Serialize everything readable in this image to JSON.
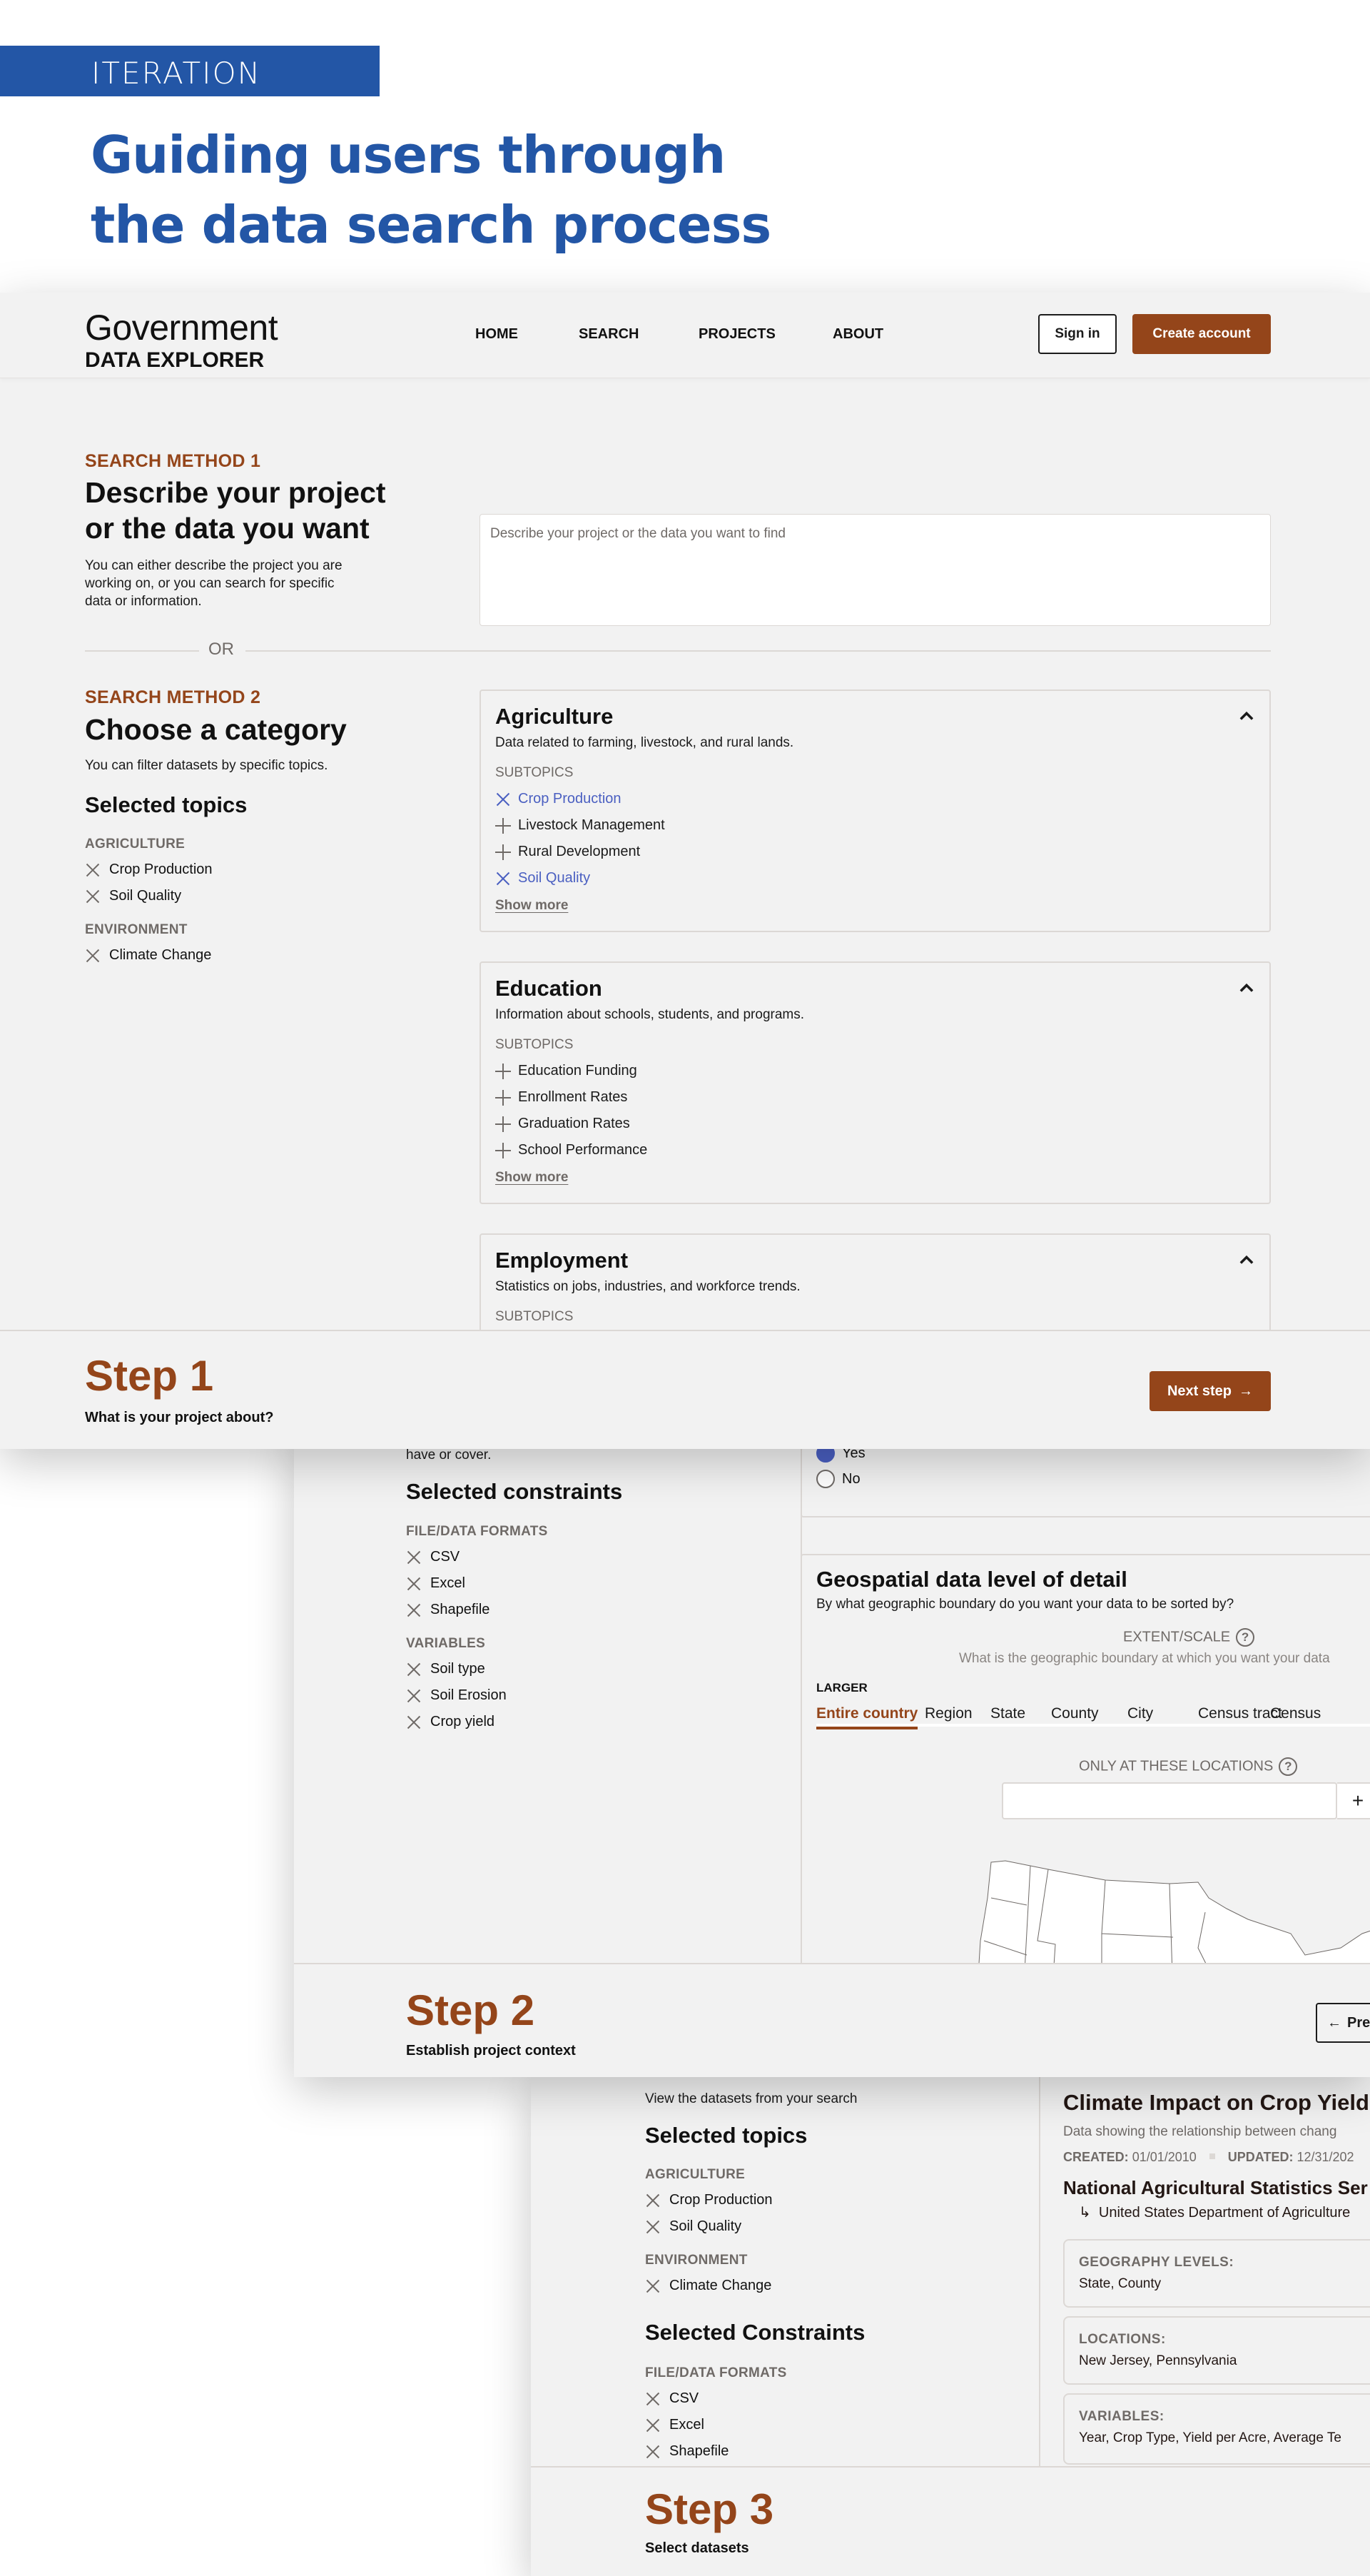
{
  "hero": {
    "tag": "ITERATION",
    "title_line1": "Guiding users through",
    "title_line2": "the data search process"
  },
  "colors": {
    "brand_blue": "#2356a6",
    "accent_brown": "#94451a",
    "selected_blue": "#4a5fc1",
    "panel_bg": "#f2f2f2"
  },
  "navbar": {
    "brand_top": "Government",
    "brand_bottom": "DATA EXPLORER",
    "links": [
      "HOME",
      "SEARCH",
      "PROJECTS",
      "ABOUT"
    ],
    "sign_in": "Sign in",
    "create_account": "Create account"
  },
  "step1": {
    "method1": {
      "label": "SEARCH METHOD 1",
      "title_line1": "Describe your project",
      "title_line2": "or the data you want",
      "desc_line1": "You can either describe the project you are",
      "desc_line2": "working on, or you can search for specific",
      "desc_line3": "data or information.",
      "placeholder": "Describe your project or the data you want to find"
    },
    "or_text": "OR",
    "method2": {
      "label": "SEARCH METHOD 2",
      "title": "Choose a category",
      "desc": "You can filter datasets by specific topics."
    },
    "selected_topics": {
      "heading": "Selected topics",
      "groups": [
        {
          "name": "AGRICULTURE",
          "items": [
            "Crop Production",
            "Soil Quality"
          ]
        },
        {
          "name": "ENVIRONMENT",
          "items": [
            "Climate Change"
          ]
        }
      ]
    },
    "categories": [
      {
        "title": "Agriculture",
        "desc": "Data related to farming, livestock, and rural lands.",
        "subtopics_label": "SUBTOPICS",
        "subtopics": [
          {
            "label": "Crop Production",
            "selected": true
          },
          {
            "label": "Livestock Management",
            "selected": false
          },
          {
            "label": "Rural Development",
            "selected": false
          },
          {
            "label": "Soil Quality",
            "selected": true
          }
        ],
        "show_more": "Show more"
      },
      {
        "title": "Education",
        "desc": "Information about schools, students, and programs.",
        "subtopics_label": "SUBTOPICS",
        "subtopics": [
          {
            "label": "Education Funding",
            "selected": false
          },
          {
            "label": "Enrollment Rates",
            "selected": false
          },
          {
            "label": "Graduation Rates",
            "selected": false
          },
          {
            "label": "School Performance",
            "selected": false
          }
        ],
        "show_more": "Show more"
      },
      {
        "title": "Employment",
        "desc": "Statistics on jobs, industries, and workforce trends.",
        "subtopics_label": "SUBTOPICS"
      }
    ],
    "footer": {
      "title": "Step 1",
      "subtitle": "What is your project about?",
      "next": "Next step"
    }
  },
  "step2": {
    "intro_tail": "have or cover.",
    "selected_constraints": {
      "heading": "Selected constraints",
      "groups": [
        {
          "name": "FILE/DATA FORMATS",
          "items": [
            "CSV",
            "Excel",
            "Shapefile"
          ]
        },
        {
          "name": "VARIABLES",
          "items": [
            "Soil type",
            "Soil Erosion",
            "Crop yield"
          ]
        }
      ]
    },
    "radio": {
      "options": [
        "Yes",
        "No"
      ],
      "selected": "Yes"
    },
    "geo": {
      "title": "Geospatial data level of detail",
      "desc": "By what geographic boundary do you want your data to be sorted by?",
      "extent_label": "EXTENT/SCALE",
      "extent_desc": "What is the geographic boundary at which you want your data",
      "larger_label": "LARGER",
      "tabs": [
        "Entire country",
        "Region",
        "State",
        "County",
        "City",
        "Census tract",
        "Census"
      ],
      "active_tab": "Entire country",
      "locations_label": "ONLY AT THESE LOCATIONS",
      "locations_value": "",
      "add_icon": "+"
    },
    "footer": {
      "title": "Step 2",
      "subtitle": "Establish project context",
      "prev": "Pre"
    }
  },
  "step3": {
    "intro": "View the datasets from your search",
    "selected_topics": {
      "heading": "Selected topics",
      "groups": [
        {
          "name": "AGRICULTURE",
          "items": [
            "Crop Production",
            "Soil Quality"
          ]
        },
        {
          "name": "ENVIRONMENT",
          "items": [
            "Climate Change"
          ]
        }
      ]
    },
    "selected_constraints": {
      "heading": "Selected Constraints",
      "groups": [
        {
          "name": "FILE/DATA FORMATS",
          "items": [
            "CSV",
            "Excel",
            "Shapefile"
          ]
        }
      ]
    },
    "dataset": {
      "title": "Climate Impact on Crop Yield",
      "desc": "Data showing the relationship between chang",
      "created_label": "CREATED:",
      "created": "01/01/2010",
      "updated_label": "UPDATED:",
      "updated": "12/31/202",
      "agency": "National Agricultural Statistics Ser",
      "parent": "United States Department of Agriculture",
      "info": [
        {
          "label": "GEOGRAPHY LEVELS:",
          "value": "State, County"
        },
        {
          "label": "LOCATIONS:",
          "value": "New Jersey, Pennsylvania"
        },
        {
          "label": "VARIABLES:",
          "value": "Year, Crop Type, Yield per Acre, Average Te"
        }
      ]
    },
    "footer": {
      "title": "Step 3",
      "subtitle": "Select datasets"
    }
  }
}
